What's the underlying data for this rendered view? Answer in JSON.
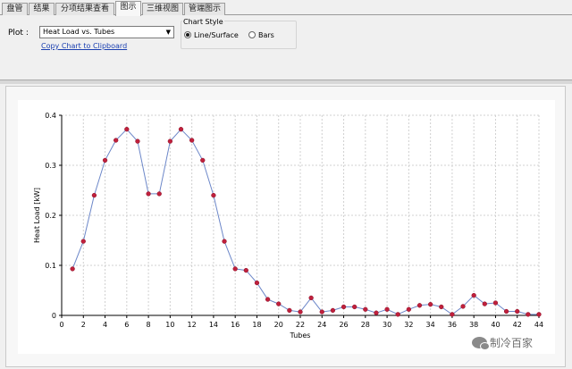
{
  "tabs": [
    {
      "label": "盘管",
      "active": false
    },
    {
      "label": "结果",
      "active": false
    },
    {
      "label": "分项结果查看",
      "active": false
    },
    {
      "label": "图示",
      "active": true
    },
    {
      "label": "三维视图",
      "active": false
    },
    {
      "label": "管端图示",
      "active": false
    }
  ],
  "controls": {
    "plot_label": "Plot :",
    "plot_selected": "Heat Load vs. Tubes",
    "copy_link": "Copy Chart to Clipboard",
    "chart_style_title": "Chart Style",
    "style_options": [
      {
        "label": "Line/Surface",
        "selected": true
      },
      {
        "label": "Bars",
        "selected": false
      }
    ]
  },
  "watermark": "制冷百家",
  "chart_data": {
    "type": "line",
    "xlabel": "Tubes",
    "ylabel": "Heat Load [kW]",
    "xlim": [
      0,
      44
    ],
    "ylim": [
      0,
      0.4
    ],
    "xticks": [
      0,
      2,
      4,
      6,
      8,
      10,
      12,
      14,
      16,
      18,
      20,
      22,
      24,
      26,
      28,
      30,
      32,
      34,
      36,
      38,
      40,
      42,
      44
    ],
    "yticks": [
      0,
      0.1,
      0.2,
      0.3,
      0.4
    ],
    "grid": true,
    "line_color": "#6b86c8",
    "marker_color": "#c0203c",
    "series": [
      {
        "x": [
          1,
          2,
          3,
          4,
          5,
          6,
          7,
          8,
          9,
          10,
          11,
          12,
          13,
          14,
          15,
          16,
          17,
          18,
          19,
          20,
          21,
          22,
          23,
          24,
          25,
          26,
          27,
          28,
          29,
          30,
          31,
          32,
          33,
          34,
          35,
          36,
          37,
          38,
          39,
          40,
          41,
          42,
          43,
          44
        ],
        "values": [
          0.093,
          0.148,
          0.24,
          0.31,
          0.35,
          0.372,
          0.348,
          0.243,
          0.243,
          0.348,
          0.372,
          0.35,
          0.31,
          0.24,
          0.148,
          0.093,
          0.09,
          0.065,
          0.032,
          0.023,
          0.01,
          0.007,
          0.035,
          0.007,
          0.01,
          0.017,
          0.017,
          0.012,
          0.005,
          0.012,
          0.002,
          0.012,
          0.02,
          0.022,
          0.017,
          0.002,
          0.018,
          0.04,
          0.023,
          0.025,
          0.008,
          0.008,
          0.002,
          0.002
        ]
      }
    ]
  }
}
